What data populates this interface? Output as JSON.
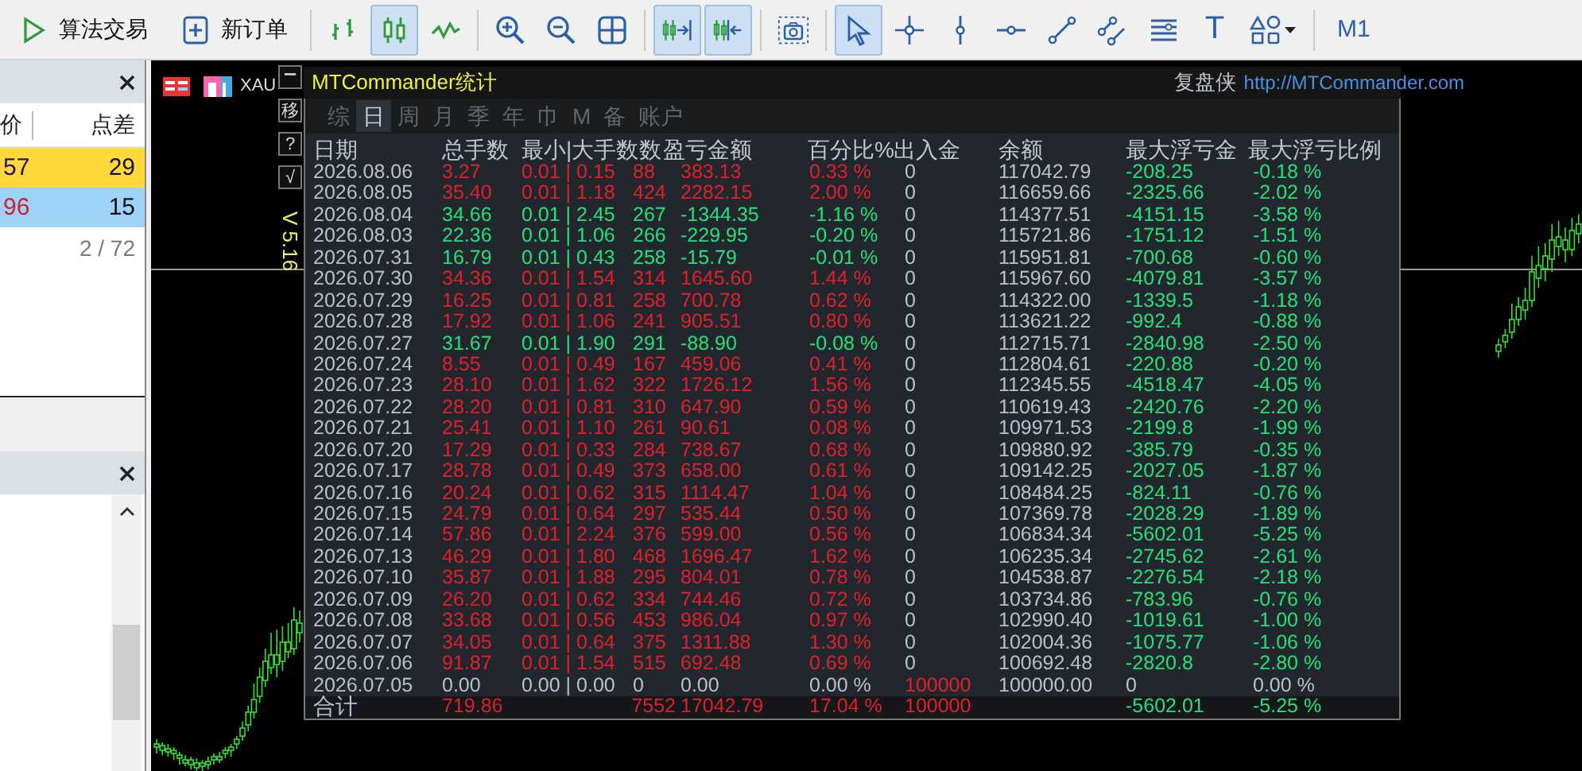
{
  "toolbar": [
    [
      {
        "kind": "algo",
        "label": "算法交易",
        "selected": false
      },
      {
        "kind": "new-order",
        "label": "新订单",
        "selected": false
      }
    ],
    [
      {
        "kind": "bar-chart",
        "selected": false
      },
      {
        "kind": "candles",
        "selected": true
      },
      {
        "kind": "line-chart",
        "selected": false
      }
    ],
    [
      {
        "kind": "zoom-in",
        "selected": false
      },
      {
        "kind": "zoom-out",
        "selected": false
      },
      {
        "kind": "tile",
        "selected": false
      }
    ],
    [
      {
        "kind": "shift",
        "selected": true
      },
      {
        "kind": "autoscroll",
        "selected": true
      }
    ],
    [
      {
        "kind": "screenshot",
        "selected": false
      }
    ],
    [
      {
        "kind": "cursor",
        "selected": true
      },
      {
        "kind": "crosshair",
        "selected": false
      },
      {
        "kind": "vline",
        "selected": false
      },
      {
        "kind": "hline",
        "selected": false
      },
      {
        "kind": "trendline",
        "selected": false
      },
      {
        "kind": "channel",
        "selected": false
      },
      {
        "kind": "lines",
        "selected": false
      },
      {
        "kind": "text",
        "label": "T",
        "selected": false
      },
      {
        "kind": "shapes",
        "selected": false
      }
    ],
    [
      {
        "kind": "period",
        "label": "M1",
        "selected": false
      }
    ]
  ],
  "market_watch": {
    "columns": [
      "价",
      "点差"
    ],
    "rows": [
      {
        "price": "57",
        "spread": "29",
        "color": "#ffd83a",
        "kind": "up"
      },
      {
        "price": "96",
        "spread": "15",
        "color": "#9ed2f7",
        "kind": "down"
      }
    ],
    "count": "2 / 72"
  },
  "chart": {
    "symbol": "XAU",
    "buttons": [
      {
        "kind": "minimize"
      },
      {
        "kind": "text",
        "label": "移"
      },
      {
        "kind": "text",
        "label": "?"
      },
      {
        "kind": "text",
        "label": "√"
      }
    ],
    "version": "V 5.16"
  },
  "stats": {
    "title": "MTCommander统计",
    "brand": "复盘侠",
    "url": "http://MTCommander.com",
    "tabs": [
      {
        "label": "综",
        "selected": false
      },
      {
        "label": "日",
        "selected": true
      },
      {
        "label": "周",
        "selected": false
      },
      {
        "label": "月",
        "selected": false
      },
      {
        "label": "季",
        "selected": false
      },
      {
        "label": "年",
        "selected": false
      },
      {
        "label": "巾",
        "selected": false
      },
      {
        "label": "M",
        "selected": false
      },
      {
        "label": "备",
        "selected": false
      },
      {
        "label": "账户",
        "selected": false
      }
    ],
    "columns": [
      "日期",
      "总手数",
      "最小|大手数",
      "数",
      "盈亏金额",
      "百分比%",
      "出入金",
      "余额",
      "最大浮亏金",
      "最大浮亏比例"
    ],
    "rows": [
      {
        "date": "2026.08.06",
        "lots": "3.27",
        "min_max": "0.01 | 0.15",
        "trades": "88",
        "pnl": "383.13",
        "pct": "0.33 %",
        "cash_flow": "0",
        "balance": "117042.79",
        "max_float": "-208.25",
        "max_float_pct": "-0.18 %",
        "kind": "gain"
      },
      {
        "date": "2026.08.05",
        "lots": "35.40",
        "min_max": "0.01 | 1.18",
        "trades": "424",
        "pnl": "2282.15",
        "pct": "2.00 %",
        "cash_flow": "0",
        "balance": "116659.66",
        "max_float": "-2325.66",
        "max_float_pct": "-2.02 %",
        "kind": "gain"
      },
      {
        "date": "2026.08.04",
        "lots": "34.66",
        "min_max": "0.01 | 2.45",
        "trades": "267",
        "pnl": "-1344.35",
        "pct": "-1.16 %",
        "cash_flow": "0",
        "balance": "114377.51",
        "max_float": "-4151.15",
        "max_float_pct": "-3.58 %",
        "kind": "loss"
      },
      {
        "date": "2026.08.03",
        "lots": "22.36",
        "min_max": "0.01 | 1.06",
        "trades": "266",
        "pnl": "-229.95",
        "pct": "-0.20 %",
        "cash_flow": "0",
        "balance": "115721.86",
        "max_float": "-1751.12",
        "max_float_pct": "-1.51 %",
        "kind": "loss"
      },
      {
        "date": "2026.07.31",
        "lots": "16.79",
        "min_max": "0.01 | 0.43",
        "trades": "258",
        "pnl": "-15.79",
        "pct": "-0.01 %",
        "cash_flow": "0",
        "balance": "115951.81",
        "max_float": "-700.68",
        "max_float_pct": "-0.60 %",
        "kind": "loss"
      },
      {
        "date": "2026.07.30",
        "lots": "34.36",
        "min_max": "0.01 | 1.54",
        "trades": "314",
        "pnl": "1645.60",
        "pct": "1.44 %",
        "cash_flow": "0",
        "balance": "115967.60",
        "max_float": "-4079.81",
        "max_float_pct": "-3.57 %",
        "kind": "gain"
      },
      {
        "date": "2026.07.29",
        "lots": "16.25",
        "min_max": "0.01 | 0.81",
        "trades": "258",
        "pnl": "700.78",
        "pct": "0.62 %",
        "cash_flow": "0",
        "balance": "114322.00",
        "max_float": "-1339.5",
        "max_float_pct": "-1.18 %",
        "kind": "gain"
      },
      {
        "date": "2026.07.28",
        "lots": "17.92",
        "min_max": "0.01 | 1.06",
        "trades": "241",
        "pnl": "905.51",
        "pct": "0.80 %",
        "cash_flow": "0",
        "balance": "113621.22",
        "max_float": "-992.4",
        "max_float_pct": "-0.88 %",
        "kind": "gain"
      },
      {
        "date": "2026.07.27",
        "lots": "31.67",
        "min_max": "0.01 | 1.90",
        "trades": "291",
        "pnl": "-88.90",
        "pct": "-0.08 %",
        "cash_flow": "0",
        "balance": "112715.71",
        "max_float": "-2840.98",
        "max_float_pct": "-2.50 %",
        "kind": "loss"
      },
      {
        "date": "2026.07.24",
        "lots": "8.55",
        "min_max": "0.01 | 0.49",
        "trades": "167",
        "pnl": "459.06",
        "pct": "0.41 %",
        "cash_flow": "0",
        "balance": "112804.61",
        "max_float": "-220.88",
        "max_float_pct": "-0.20 %",
        "kind": "gain"
      },
      {
        "date": "2026.07.23",
        "lots": "28.10",
        "min_max": "0.01 | 1.62",
        "trades": "322",
        "pnl": "1726.12",
        "pct": "1.56 %",
        "cash_flow": "0",
        "balance": "112345.55",
        "max_float": "-4518.47",
        "max_float_pct": "-4.05 %",
        "kind": "gain"
      },
      {
        "date": "2026.07.22",
        "lots": "28.20",
        "min_max": "0.01 | 0.81",
        "trades": "310",
        "pnl": "647.90",
        "pct": "0.59 %",
        "cash_flow": "0",
        "balance": "110619.43",
        "max_float": "-2420.76",
        "max_float_pct": "-2.20 %",
        "kind": "gain"
      },
      {
        "date": "2026.07.21",
        "lots": "25.41",
        "min_max": "0.01 | 1.10",
        "trades": "261",
        "pnl": "90.61",
        "pct": "0.08 %",
        "cash_flow": "0",
        "balance": "109971.53",
        "max_float": "-2199.8",
        "max_float_pct": "-1.99 %",
        "kind": "gain"
      },
      {
        "date": "2026.07.20",
        "lots": "17.29",
        "min_max": "0.01 | 0.33",
        "trades": "284",
        "pnl": "738.67",
        "pct": "0.68 %",
        "cash_flow": "0",
        "balance": "109880.92",
        "max_float": "-385.79",
        "max_float_pct": "-0.35 %",
        "kind": "gain"
      },
      {
        "date": "2026.07.17",
        "lots": "28.78",
        "min_max": "0.01 | 0.49",
        "trades": "373",
        "pnl": "658.00",
        "pct": "0.61 %",
        "cash_flow": "0",
        "balance": "109142.25",
        "max_float": "-2027.05",
        "max_float_pct": "-1.87 %",
        "kind": "gain"
      },
      {
        "date": "2026.07.16",
        "lots": "20.24",
        "min_max": "0.01 | 0.62",
        "trades": "315",
        "pnl": "1114.47",
        "pct": "1.04 %",
        "cash_flow": "0",
        "balance": "108484.25",
        "max_float": "-824.11",
        "max_float_pct": "-0.76 %",
        "kind": "gain"
      },
      {
        "date": "2026.07.15",
        "lots": "24.79",
        "min_max": "0.01 | 0.64",
        "trades": "297",
        "pnl": "535.44",
        "pct": "0.50 %",
        "cash_flow": "0",
        "balance": "107369.78",
        "max_float": "-2028.29",
        "max_float_pct": "-1.89 %",
        "kind": "gain"
      },
      {
        "date": "2026.07.14",
        "lots": "57.86",
        "min_max": "0.01 | 2.24",
        "trades": "376",
        "pnl": "599.00",
        "pct": "0.56 %",
        "cash_flow": "0",
        "balance": "106834.34",
        "max_float": "-5602.01",
        "max_float_pct": "-5.25 %",
        "kind": "gain"
      },
      {
        "date": "2026.07.13",
        "lots": "46.29",
        "min_max": "0.01 | 1.80",
        "trades": "468",
        "pnl": "1696.47",
        "pct": "1.62 %",
        "cash_flow": "0",
        "balance": "106235.34",
        "max_float": "-2745.62",
        "max_float_pct": "-2.61 %",
        "kind": "gain"
      },
      {
        "date": "2026.07.10",
        "lots": "35.87",
        "min_max": "0.01 | 1.88",
        "trades": "295",
        "pnl": "804.01",
        "pct": "0.78 %",
        "cash_flow": "0",
        "balance": "104538.87",
        "max_float": "-2276.54",
        "max_float_pct": "-2.18 %",
        "kind": "gain"
      },
      {
        "date": "2026.07.09",
        "lots": "26.20",
        "min_max": "0.01 | 0.62",
        "trades": "334",
        "pnl": "744.46",
        "pct": "0.72 %",
        "cash_flow": "0",
        "balance": "103734.86",
        "max_float": "-783.96",
        "max_float_pct": "-0.76 %",
        "kind": "gain"
      },
      {
        "date": "2026.07.08",
        "lots": "33.68",
        "min_max": "0.01 | 0.56",
        "trades": "453",
        "pnl": "986.04",
        "pct": "0.97 %",
        "cash_flow": "0",
        "balance": "102990.40",
        "max_float": "-1019.61",
        "max_float_pct": "-1.00 %",
        "kind": "gain"
      },
      {
        "date": "2026.07.07",
        "lots": "34.05",
        "min_max": "0.01 | 0.64",
        "trades": "375",
        "pnl": "1311.88",
        "pct": "1.30 %",
        "cash_flow": "0",
        "balance": "102004.36",
        "max_float": "-1075.77",
        "max_float_pct": "-1.06 %",
        "kind": "gain"
      },
      {
        "date": "2026.07.06",
        "lots": "91.87",
        "min_max": "0.01 | 1.54",
        "trades": "515",
        "pnl": "692.48",
        "pct": "0.69 %",
        "cash_flow": "0",
        "balance": "100692.48",
        "max_float": "-2820.8",
        "max_float_pct": "-2.80 %",
        "kind": "gain"
      },
      {
        "date": "2026.07.05",
        "lots": "0.00",
        "min_max": "0.00 | 0.00",
        "trades": "0",
        "pnl": "0.00",
        "pct": "0.00 %",
        "cash_flow": "100000",
        "balance": "100000.00",
        "max_float": "0",
        "max_float_pct": "0.00 %",
        "kind": "deposit"
      }
    ],
    "total": {
      "label": "合计",
      "lots": "719.86",
      "trades": "7552",
      "pnl": "17042.79",
      "pct": "17.04 %",
      "cash_flow": "100000",
      "max_float": "-5602.01",
      "max_float_pct": "-5.25 %"
    }
  }
}
